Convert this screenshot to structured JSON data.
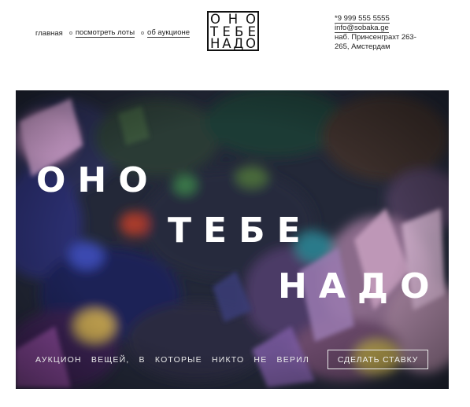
{
  "nav": {
    "home": "главная",
    "lots": "посмотреть лоты",
    "about": "об аукционе"
  },
  "logo": {
    "rows": [
      [
        "О",
        "Н",
        "О"
      ],
      [
        "Т",
        "Е",
        "Б",
        "Е"
      ],
      [
        "Н",
        "А",
        "Д",
        "О"
      ]
    ]
  },
  "contacts": {
    "phone": "*9 999 555 5555",
    "email": "info@sobaka.ge",
    "address_line1": "наб. Принсенграхт 263-",
    "address_line2": "265, Амстердам"
  },
  "hero": {
    "word1": "ОНО",
    "word2": "ТЕБЕ",
    "word3": "НАДО",
    "tagline": "АУКЦИОН ВЕЩЕЙ, В КОТОРЫЕ НИКТО НЕ ВЕРИЛ",
    "cta": "СДЕЛАТЬ СТАВКУ"
  }
}
